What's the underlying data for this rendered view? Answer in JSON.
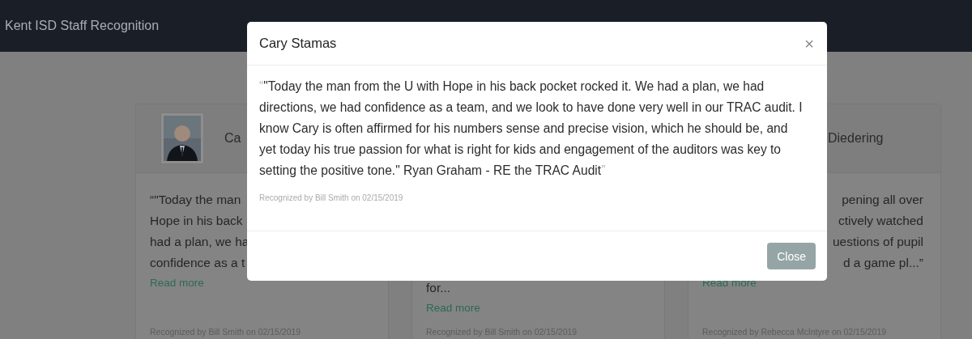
{
  "navbar": {
    "title": "Kent ISD Staff Recognition"
  },
  "cards": [
    {
      "name": "Ca",
      "lines": [
        "“\"Today the man",
        "Hope in his back",
        "had a plan, we ha",
        "confidence as a t"
      ],
      "read_more": "Read more",
      "recognized": "Recognized by Bill Smith on 02/15/2019"
    },
    {
      "lines": [
        "for..."
      ],
      "read_more": "Read more",
      "recognized": "Recognized by Bill Smith on 02/15/2019"
    },
    {
      "name": "Diedering",
      "lines": [
        "pening all over",
        "ctively watched",
        "uestions of pupil",
        "d a game pl...”"
      ],
      "read_more": "Read more",
      "recognized": "Recognized by Rebecca McIntyre on 02/15/2019"
    }
  ],
  "modal": {
    "title": "Cary Stamas",
    "close_icon": "×",
    "quote_open": "“",
    "quote": "\"Today the man from the U with Hope in his back pocket rocked it. We had a plan, we had directions, we had confidence as a team, and we look to have done very well in our TRAC audit. I know Cary is often affirmed for his numbers sense and precise vision, which he should be, and yet today his true passion for what is right for kids and engagement of the auditors was key to setting the positive tone.\" Ryan Graham - RE the TRAC Audit",
    "quote_close": "”",
    "recognized": "Recognized by Bill Smith on 02/15/2019",
    "button": "Close"
  }
}
